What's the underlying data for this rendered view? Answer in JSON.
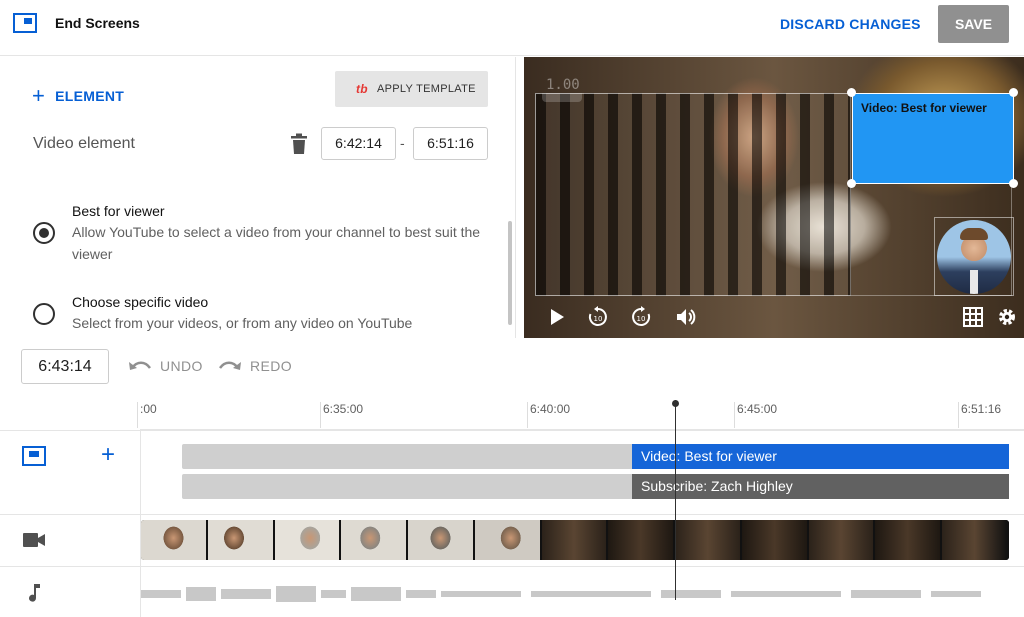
{
  "header": {
    "title": "End Screens",
    "discard_label": "DISCARD CHANGES",
    "save_label": "SAVE"
  },
  "editor": {
    "add_element_label": "ELEMENT",
    "apply_template_label": "APPLY TEMPLATE",
    "element_type": "Video element",
    "start_time": "6:42:14",
    "end_time": "6:51:16",
    "time_separator": "-",
    "options": [
      {
        "title": "Best for viewer",
        "description": "Allow YouTube to select a video from your channel to best suit the viewer",
        "selected": true
      },
      {
        "title": "Choose specific video",
        "description": "Select from your videos, or from any video on YouTube",
        "selected": false
      }
    ]
  },
  "preview": {
    "aspect_label": "1.00",
    "element_box_label": "Video: Best for viewer",
    "controls": [
      "play-icon",
      "rewind-10-icon",
      "forward-10-icon",
      "volume-icon",
      "grid-icon",
      "gear-icon"
    ]
  },
  "timeline": {
    "current_time": "6:43:14",
    "undo_label": "UNDO",
    "redo_label": "REDO",
    "ruler": [
      ":00",
      "6:35:00",
      "6:40:00",
      "6:45:00",
      "6:51:16"
    ],
    "tracks": {
      "video_element": "Video: Best for viewer",
      "subscribe_element": "Subscribe: Zach Highley"
    }
  },
  "colors": {
    "accent": "#065fd4",
    "element_bar": "#1565d8",
    "subscribe_bar": "#616161",
    "preview_element": "#2196f3"
  }
}
